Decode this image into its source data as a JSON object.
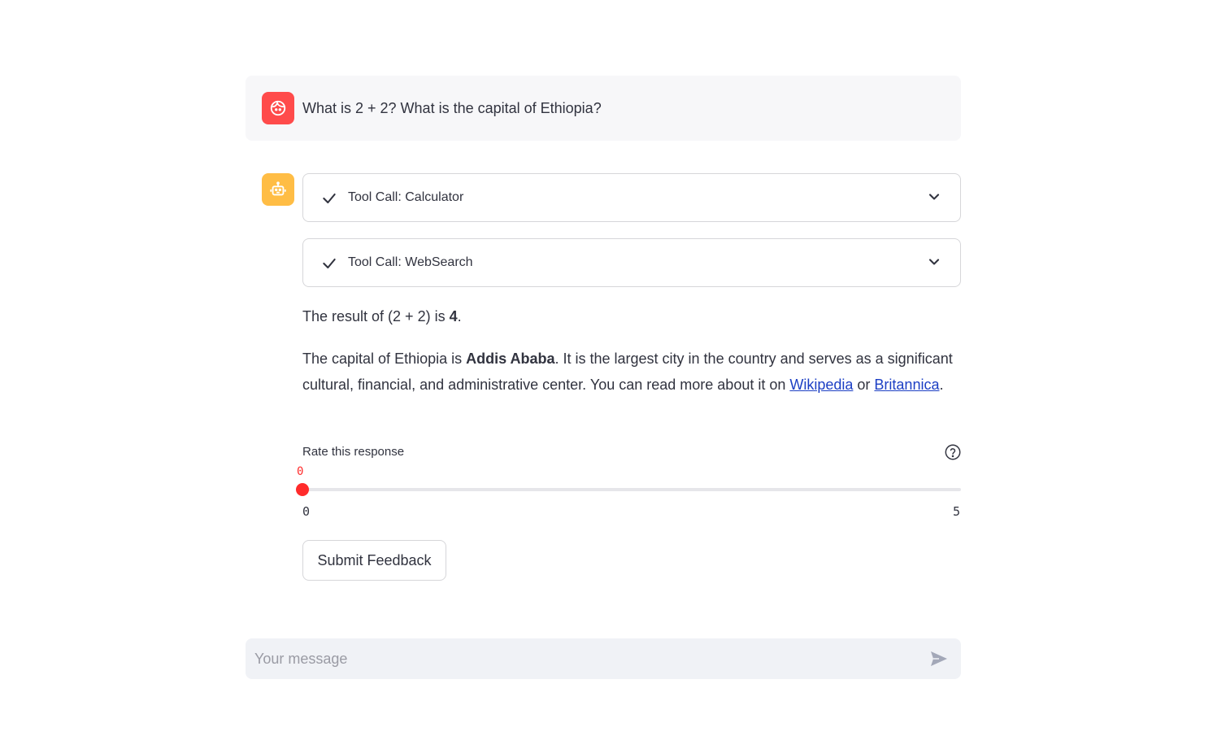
{
  "user_message": {
    "text": "What is 2 + 2? What is the capital of Ethiopia?",
    "avatar_icon": "user-face-icon",
    "avatar_color": "#ff4b4b"
  },
  "assistant": {
    "avatar_icon": "robot-icon",
    "avatar_color": "#ffbd45",
    "tool_calls": [
      {
        "label": "Tool Call: Calculator",
        "status_icon": "check-icon",
        "toggle_icon": "chevron-down-icon"
      },
      {
        "label": "Tool Call: WebSearch",
        "status_icon": "check-icon",
        "toggle_icon": "chevron-down-icon"
      }
    ],
    "paragraph1": {
      "prefix": "The result of (2 + 2) is ",
      "bold": "4",
      "suffix": "."
    },
    "paragraph2": {
      "prefix": "The capital of Ethiopia is ",
      "bold": "Addis Ababa",
      "middle": ". It is the largest city in the country and serves as a significant cultural, financial, and administrative center. You can read more about it on ",
      "link1": "Wikipedia",
      "connector": " or ",
      "link2": "Britannica",
      "suffix": "."
    },
    "link_color": "#1c3fc4"
  },
  "feedback": {
    "label": "Rate this response",
    "help_icon": "help-circle-icon",
    "slider": {
      "value": "0",
      "min": "0",
      "max": "5",
      "fraction": 0
    },
    "accent_color": "#ff2b2b",
    "submit_label": "Submit Feedback"
  },
  "chat_input": {
    "placeholder": "Your message",
    "send_icon": "send-icon"
  }
}
